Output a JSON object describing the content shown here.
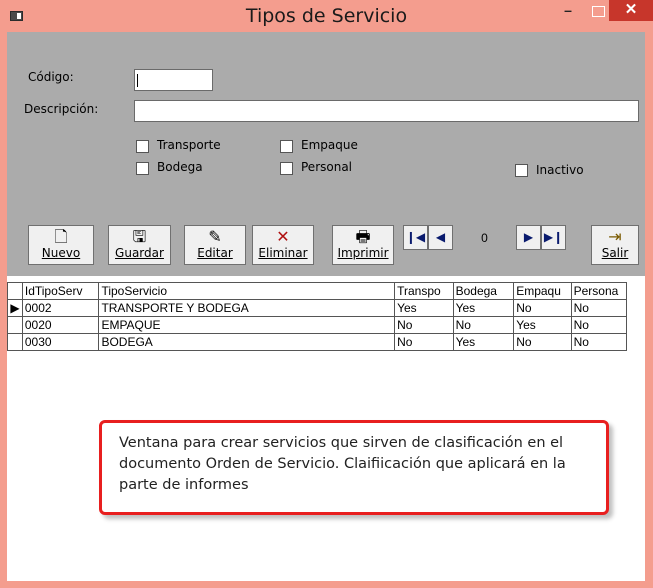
{
  "window": {
    "title": "Tipos de Servicio",
    "minimize": "–",
    "close": "✕"
  },
  "form": {
    "codigo_label": "Código:",
    "codigo_value": "",
    "descripcion_label": "Descripción:",
    "descripcion_value": "",
    "checkboxes": {
      "transporte": "Transporte",
      "empaque": "Empaque",
      "bodega": "Bodega",
      "personal": "Personal",
      "inactivo": "Inactivo"
    }
  },
  "toolbar": {
    "nuevo": "Nuevo",
    "guardar": "Guardar",
    "editar": "Editar",
    "eliminar": "Eliminar",
    "imprimir": "Imprimir",
    "salir": "Salir",
    "record_number": "0"
  },
  "grid": {
    "headers": [
      "IdTipoServ",
      "TipoServicio",
      "Transpo",
      "Bodega",
      "Empaqu",
      "Persona"
    ],
    "rows": [
      [
        "0002",
        "TRANSPORTE Y BODEGA",
        "Yes",
        "Yes",
        "No",
        "No"
      ],
      [
        "0020",
        "EMPAQUE",
        "No",
        "No",
        "Yes",
        "No"
      ],
      [
        "0030",
        "BODEGA",
        "No",
        "Yes",
        "No",
        "No"
      ]
    ]
  },
  "callout": {
    "text": "Ventana para crear servicios que sirven de clasificación en el documento Orden de Servicio. Claifiicación que aplicará en la parte de informes"
  }
}
